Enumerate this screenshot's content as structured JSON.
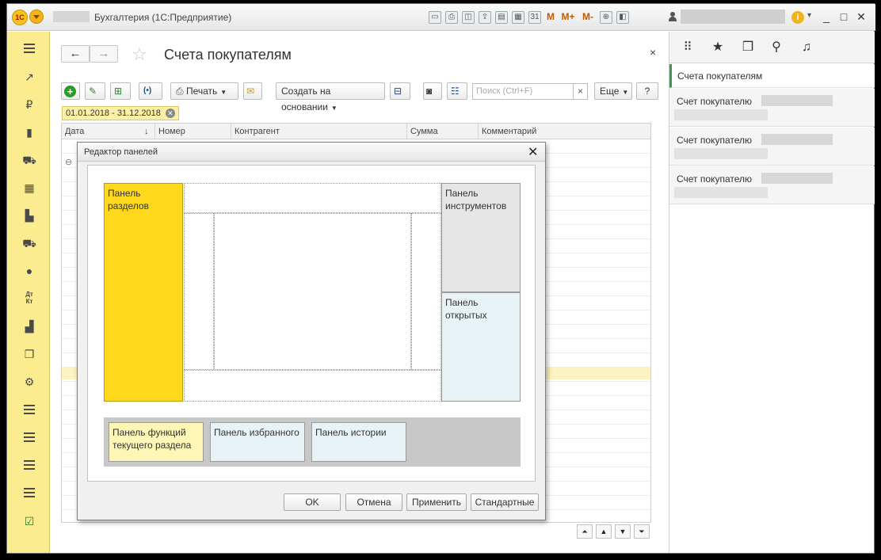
{
  "app": {
    "title": "Бухгалтерия  (1С:Предприятие)",
    "logo_text": "1С",
    "window_controls": [
      "_",
      "□",
      "✕"
    ],
    "info_icon_text": "i",
    "quick_icons": [
      "save-icon",
      "print-icon",
      "preview-icon",
      "upload-icon",
      "doc-icon",
      "calc-icon",
      "calendar-icon"
    ],
    "memory_labels": [
      "M",
      "M+",
      "M-"
    ],
    "calendar_day": "31"
  },
  "section_panel": {
    "items": [
      "menu-icon",
      "chart-icon",
      "money-icon",
      "bag-icon",
      "cart-icon",
      "grid-icon",
      "factory-icon",
      "truck-icon",
      "user-icon",
      "dt-kt-icon",
      "bar-chart-icon",
      "docs-icon",
      "gear-icon",
      "list-icon",
      "list-icon",
      "list-icon",
      "list-icon",
      "task-icon"
    ],
    "dt_kt_label_top": "Дт",
    "dt_kt_label_bottom": "Кт"
  },
  "form": {
    "title": "Счета покупателям",
    "back_arrow": "←",
    "forward_arrow": "→",
    "close": "×",
    "toolbar": {
      "print_label": "Печать",
      "create_based_label": "Создать на основании",
      "search_placeholder": "Поиск (Ctrl+F)",
      "search_clear": "×",
      "more_label": "Еще",
      "help_label": "?"
    },
    "filter_period": "01.01.2018 - 31.12.2018",
    "columns": {
      "date": "Дата",
      "sort_arrow": "↓",
      "number": "Номер",
      "contractor": "Контрагент",
      "sum": "Сумма",
      "comment": "Комментарий"
    },
    "tree_toggle": "⊖",
    "nav_arrows": [
      "⏶",
      "▲",
      "▼",
      "⏷"
    ]
  },
  "right_panel": {
    "active_item": "Счета покупателям",
    "history": [
      {
        "label": "Счет покупателю"
      },
      {
        "label": "Счет покупателю"
      },
      {
        "label": "Счет покупателю"
      }
    ]
  },
  "dialog": {
    "title": "Редактор панелей",
    "close": "✕",
    "panels": {
      "sections": "Панель разделов",
      "tools": "Панель инструментов",
      "open": "Панель открытых",
      "functions": "Панель функций текущего раздела",
      "favorites": "Панель избранного",
      "history": "Панель истории"
    },
    "buttons": {
      "ok": "OK",
      "cancel": "Отмена",
      "apply": "Применить",
      "standard": "Стандартные"
    },
    "colors": {
      "sections": "#fdd81b",
      "tools": "#e6e6e6",
      "open": "#e8f3f8",
      "functions": "#fdf6b6",
      "favorites": "#e8f3f8",
      "history": "#e8f3f8",
      "bottom_strip": "#c8c8c8"
    }
  }
}
